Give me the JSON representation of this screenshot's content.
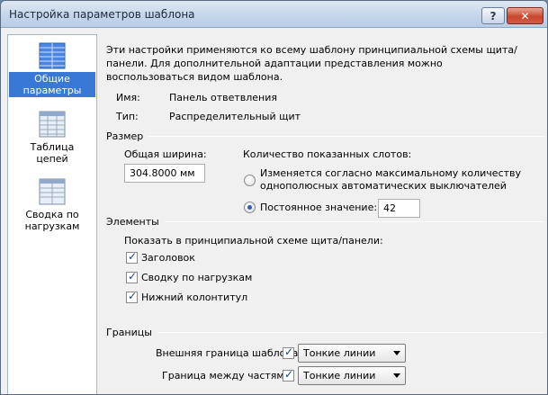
{
  "window": {
    "title": "Настройка параметров шаблона",
    "help_label": "?",
    "close_label": "✕"
  },
  "sidebar": {
    "items": [
      {
        "label": "Общие параметры",
        "icon": "grid-icon",
        "active": true
      },
      {
        "label": "Таблица цепей",
        "icon": "table-icon",
        "active": false
      },
      {
        "label": "Сводка по нагрузкам",
        "icon": "summary-icon",
        "active": false
      }
    ]
  },
  "main": {
    "intro": "Эти настройки применяются ко всему шаблону принципиальной схемы щита/панели. Для дополнительной адаптации представления можно воспользоваться видом шаблона.",
    "name_label": "Имя:",
    "name_value": "Панель ответвления",
    "type_label": "Тип:",
    "type_value": "Распределительный щит",
    "size": {
      "section_label": "Размер",
      "total_width_label": "Общая ширина:",
      "total_width_value": "304.8000 мм",
      "slots_label": "Количество показанных слотов:",
      "option_auto": "Изменяется согласно максимальному количеству однополюсных автоматических выключателей",
      "option_fixed": "Постоянное значение:",
      "fixed_value": "42"
    },
    "elements": {
      "section_label": "Элементы",
      "show_label": "Показать в принципиальной схеме щита/панели:",
      "header_label": "Заголовок",
      "summary_label": "Сводку по нагрузкам",
      "footer_label": "Нижний колонтитул"
    },
    "borders": {
      "section_label": "Границы",
      "outer_label": "Внешняя граница шаблона:",
      "outer_value": "Тонкие линии",
      "between_label": "Граница между частями:",
      "between_value": "Тонкие линии"
    }
  }
}
